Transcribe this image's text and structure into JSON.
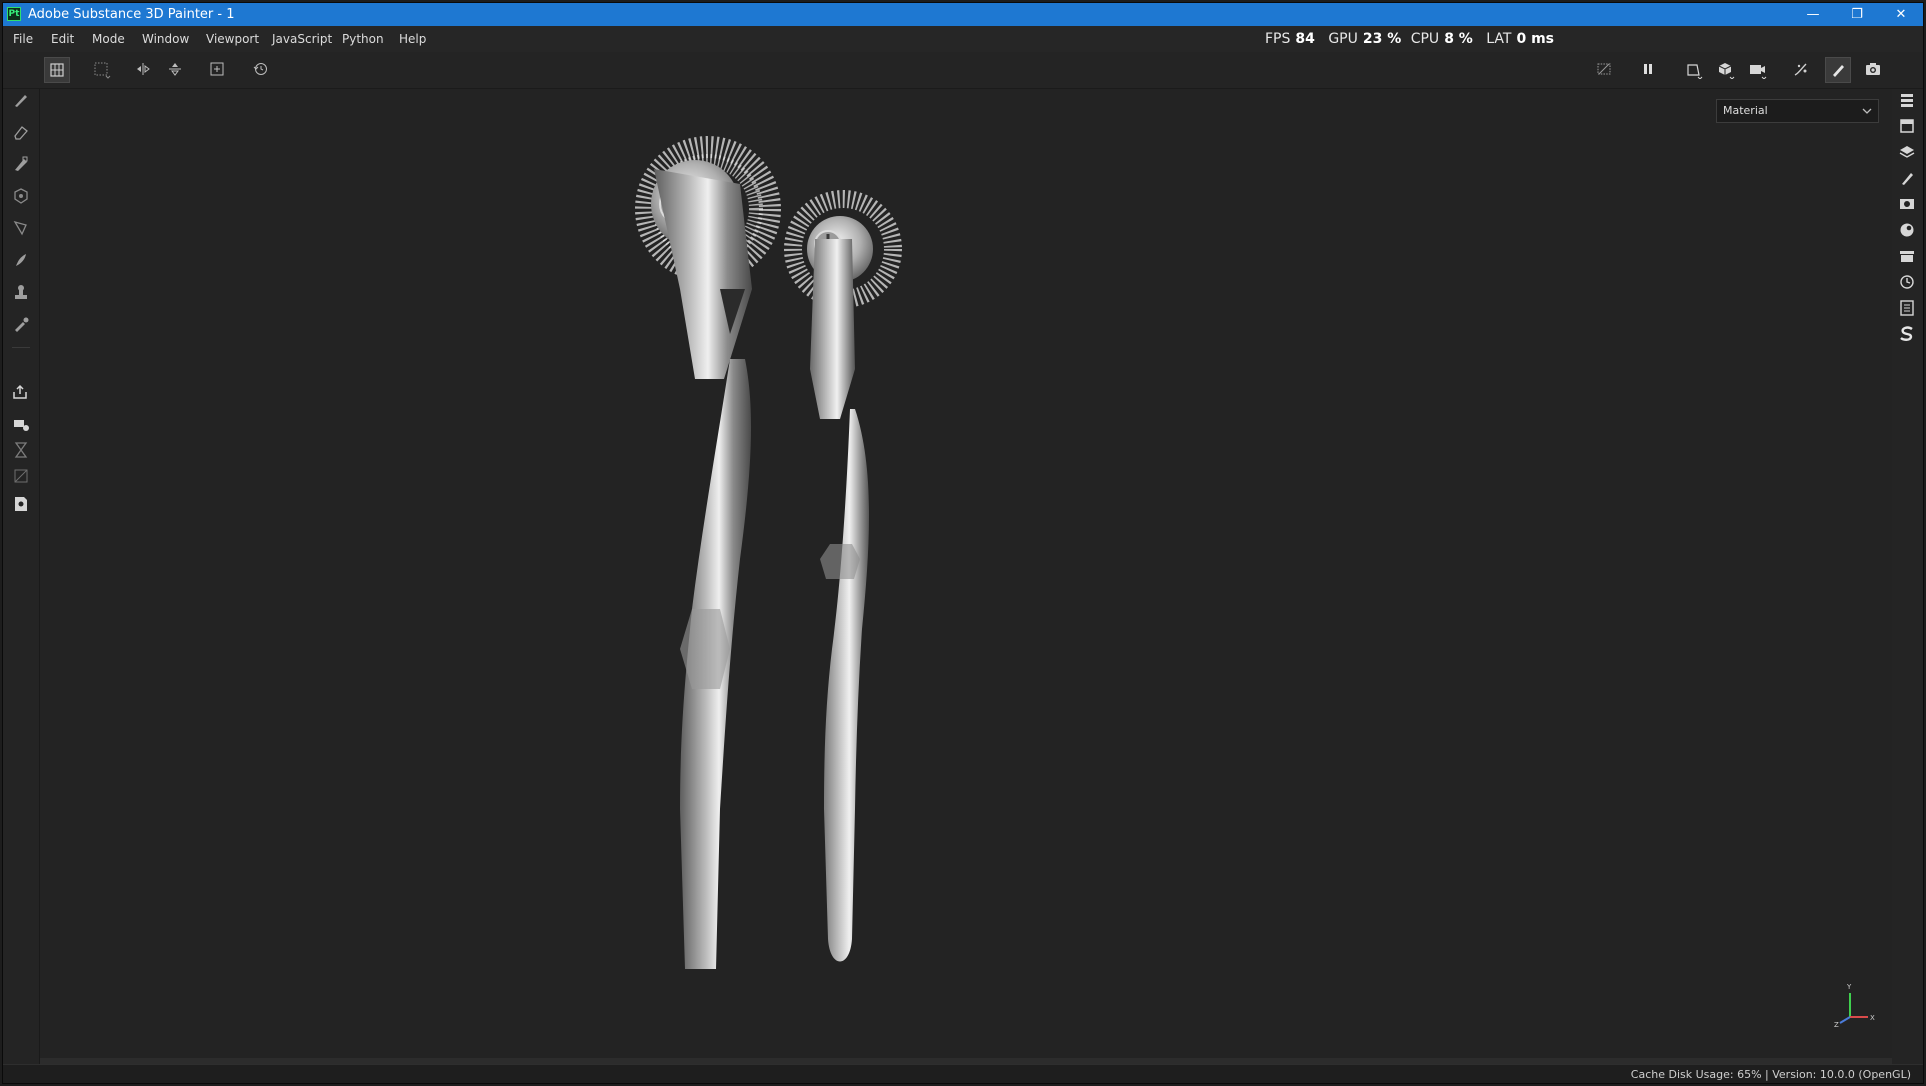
{
  "window": {
    "app_badge": "Pt",
    "title": "Adobe Substance 3D Painter - 1",
    "controls": {
      "minimize": "—",
      "restore": "❐",
      "close": "✕"
    }
  },
  "menu": {
    "items": [
      "File",
      "Edit",
      "Mode",
      "Window",
      "Viewport",
      "JavaScript",
      "Python",
      "Help"
    ]
  },
  "stats": {
    "fps_label": "FPS",
    "fps_value": "84",
    "gpu_label": "GPU",
    "gpu_value": "23 %",
    "cpu_label": "CPU",
    "cpu_value": "8 %",
    "lat_label": "LAT",
    "lat_value": "0 ms"
  },
  "toolbar": {
    "left_icons": [
      "selection-mode-icon",
      "grid-select-icon",
      "symmetry-x-icon",
      "symmetry-y-icon",
      "add-frame-icon",
      "reset-camera-icon"
    ],
    "right_icons": [
      "hide-icon",
      "pause-icon",
      "view-2d-icon",
      "view-3d-icon",
      "camera-icon",
      "effects-icon",
      "paint-brush-icon",
      "screenshot-icon"
    ]
  },
  "left_tools": [
    "paint-icon",
    "eraser-icon",
    "projection-icon",
    "geometry-mask-icon",
    "polygon-fill-icon",
    "smudge-icon",
    "clone-icon",
    "color-picker-icon",
    "export-icon",
    "bake-icon",
    "hourglass-icon",
    "uv-icon",
    "report-icon"
  ],
  "right_dock": [
    "layers-stack-icon",
    "texture-set-icon",
    "layers-icon",
    "properties-icon",
    "display-settings-icon",
    "shelf-icon",
    "archive-icon",
    "history-icon",
    "log-icon",
    "substance-icon"
  ],
  "viewport": {
    "mode_select": {
      "value": "Material"
    },
    "gizmo": {
      "y_label": "Y",
      "x_label": "X",
      "z_label": "Z"
    },
    "colors": {
      "background": "#232323",
      "metal": "#9a9a9a",
      "highlight": "#e8e8e8"
    }
  },
  "status": {
    "text": "Cache Disk Usage:   65% | Version: 10.0.0 (OpenGL)"
  },
  "colors": {
    "titlebar": "#1e78d2",
    "panel": "#242424",
    "accent_green": "#36ee7b"
  }
}
